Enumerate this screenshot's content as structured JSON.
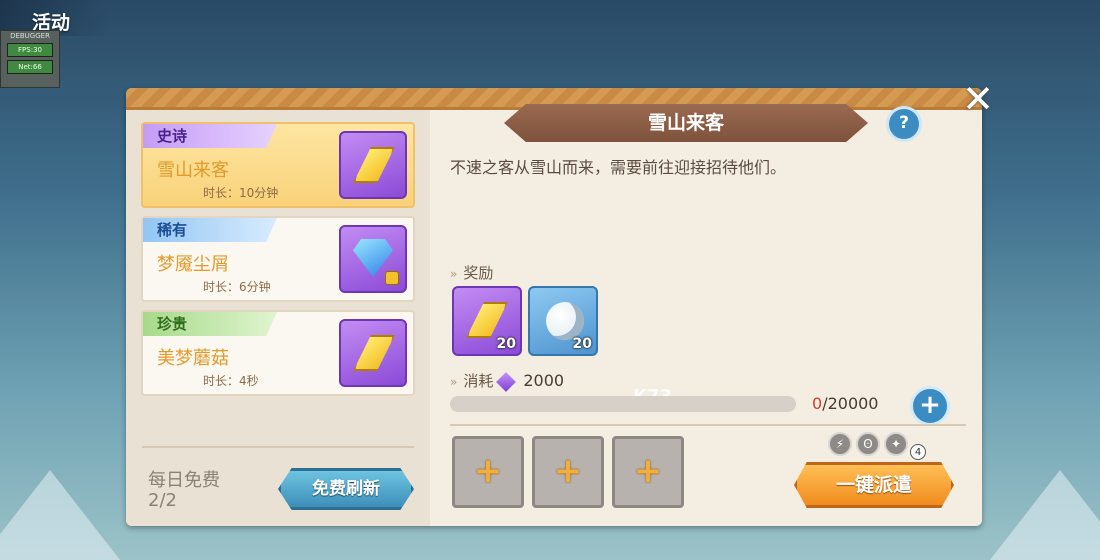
{
  "header": {
    "title": "活动"
  },
  "debugger": {
    "title": "DEBUGGER",
    "fps": "FPS:30",
    "net": "Net:66"
  },
  "quests": [
    {
      "rarity": "史诗",
      "name": "雪山来客",
      "duration": "时长：10分钟",
      "icon": "yellow-crystal-icon"
    },
    {
      "rarity": "稀有",
      "name": "梦魇尘屑",
      "duration": "时长：6分钟",
      "icon": "blue-diamond-icon"
    },
    {
      "rarity": "珍贵",
      "name": "美梦蘑菇",
      "duration": "时长：4秒",
      "icon": "yellow-crystal-icon"
    }
  ],
  "daily": {
    "label": "每日免费",
    "count": "2/2",
    "refresh_label": "免费刷新"
  },
  "detail": {
    "title": "雪山来客",
    "help": "?",
    "description": "不速之客从雪山而来，需要前往迎接招待他们。",
    "reward_label": "奖励",
    "rewards": [
      {
        "icon": "yellow-crystal-icon",
        "count": "20"
      },
      {
        "icon": "moon-coin-icon",
        "count": "20"
      }
    ],
    "cost_label": "消耗",
    "cost_value": "2000",
    "progress_current": "0",
    "progress_max": "/20000",
    "progress_fraction": 0.0,
    "req_badge": "4",
    "dispatch_label": "一键派遣"
  },
  "close_label": "✕",
  "watermark": "K73",
  "colors": {
    "accent": "#f08c1f",
    "blue": "#3b8cc3",
    "epic": "#c59cf6",
    "rare": "#93c6f3",
    "precious": "#a7d98a"
  }
}
